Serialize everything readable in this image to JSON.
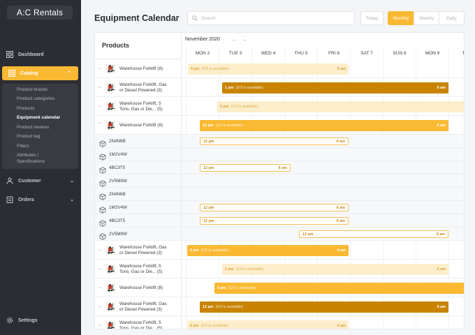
{
  "app": {
    "logo": "A:C Rentals"
  },
  "sidebar": {
    "dashboard": "Dashboard",
    "catalog": "Catalog",
    "customer": "Customer",
    "orders": "Orders",
    "settings": "Settings",
    "catalog_items": [
      "Product brands",
      "Product categories",
      "Products",
      "Equipment calendar",
      "Product reviews",
      "Product tag",
      "Filters",
      "Attributes /",
      "Specifications"
    ]
  },
  "header": {
    "title": "Equipment Calendar",
    "search_placeholder": "Search",
    "views": [
      "Today",
      "Monthly",
      "Weekly",
      "Daily"
    ],
    "active_view": "Monthly"
  },
  "calendar": {
    "products_heading": "Products",
    "month": "November 2020",
    "prev": "←",
    "next": "→",
    "days": [
      "MON 2",
      "TUE 3",
      "WED 4",
      "THU 5",
      "FRI 6",
      "SAT 7",
      "SUN 8",
      "MON 9",
      "TU"
    ],
    "rows": [
      {
        "kind": "product",
        "chevron": "⌄",
        "label": [
          "Warehouse Forklift (8)"
        ]
      },
      {
        "kind": "product",
        "chevron": "⌄",
        "label": [
          "Warehouse Forklift, Gas",
          "or Diesel Powered (3)"
        ]
      },
      {
        "kind": "product",
        "chevron": "⌄",
        "label": [
          "Warehouse Forklift, 5",
          "Tons, Gas or Die... (5)"
        ]
      },
      {
        "kind": "product",
        "chevron": "⌃",
        "label": [
          "Warehouse Forklift (8)"
        ]
      },
      {
        "kind": "unit",
        "label": "2N4N6B"
      },
      {
        "kind": "unit",
        "label": "1M2V4W"
      },
      {
        "kind": "unit",
        "label": "4BC3T5"
      },
      {
        "kind": "unit",
        "label": "2V5M8W"
      },
      {
        "kind": "unit",
        "label": "2N4N6B"
      },
      {
        "kind": "unit",
        "label": "1M2V4W"
      },
      {
        "kind": "unit",
        "label": "4BC3T5"
      },
      {
        "kind": "unit",
        "label": "2V5M8W"
      },
      {
        "kind": "product",
        "chevron": "⌄",
        "label": [
          "Warehouse Forklift, Gas",
          "or Diesel Powered (3)"
        ]
      },
      {
        "kind": "product",
        "chevron": "⌄",
        "label": [
          "Warehouse Forklift, 5",
          "Tons, Gas or Die... (5)"
        ]
      },
      {
        "kind": "product",
        "chevron": "⌄",
        "label": [
          "Warehouse Forklift (8)"
        ]
      },
      {
        "kind": "product",
        "chevron": "⌄",
        "label": [
          "Warehouse Forklift, Gas",
          "or Diesel Powered (3)"
        ]
      },
      {
        "kind": "product",
        "chevron": "⌄",
        "label": [
          "Warehouse Forklift, 5",
          "Tons, Gas or Die... (5)"
        ]
      }
    ],
    "bookings": [
      {
        "row": 0,
        "style": "light",
        "start": "6 pm",
        "status": "(2/3 is available)",
        "end": "6 am"
      },
      {
        "row": 1,
        "style": "dark",
        "start": "1 pm",
        "status": "(0/3 is available)",
        "end": "6 am"
      },
      {
        "row": 2,
        "style": "light",
        "start": "6 pm",
        "status": "(1/3 is available)",
        "end": ""
      },
      {
        "row": 3,
        "style": "mid",
        "start": "12 pm",
        "status": "(1/3 is available)",
        "end": "6 am"
      },
      {
        "row": 4,
        "style": "outline",
        "start": "12 pm",
        "status": "",
        "end": "6 am"
      },
      {
        "row": 6,
        "style": "outline",
        "start": "12 pm",
        "status": "",
        "end": "6 am"
      },
      {
        "row": 9,
        "style": "outline",
        "start": "12 pm",
        "status": "",
        "end": "6 am"
      },
      {
        "row": 10,
        "style": "outline",
        "start": "12 pm",
        "status": "",
        "end": "6 am"
      },
      {
        "row": 11,
        "style": "outline",
        "start": "12 pm",
        "status": "",
        "end": "6 am"
      },
      {
        "row": 12,
        "style": "mid",
        "start": "6 pm",
        "status": "(1/3 is available)",
        "end": "6 am"
      },
      {
        "row": 13,
        "style": "light",
        "start": "1 pm",
        "status": "(1/3 is available)",
        "end": "6 am"
      },
      {
        "row": 14,
        "style": "mid",
        "start": "6 pm",
        "status": "(1/3 is available)",
        "end": ""
      },
      {
        "row": 15,
        "style": "dark",
        "start": "12 pm",
        "status": "(0/3 is available)",
        "end": "6 am"
      },
      {
        "row": 16,
        "style": "light",
        "start": "6 pm",
        "status": "(2/3 is available)",
        "end": "6 am"
      }
    ]
  },
  "colors": {
    "accent": "#f9b932",
    "accent_dark": "#c88400",
    "accent_light": "#fdeecb",
    "sidebar": "#2b2d33"
  },
  "icons": {
    "dashboard": "grid-icon",
    "catalog": "catalog-icon",
    "customer": "user-icon",
    "orders": "clipboard-icon",
    "settings": "gear-icon",
    "unit": "box-icon",
    "product": "forklift-icon"
  }
}
